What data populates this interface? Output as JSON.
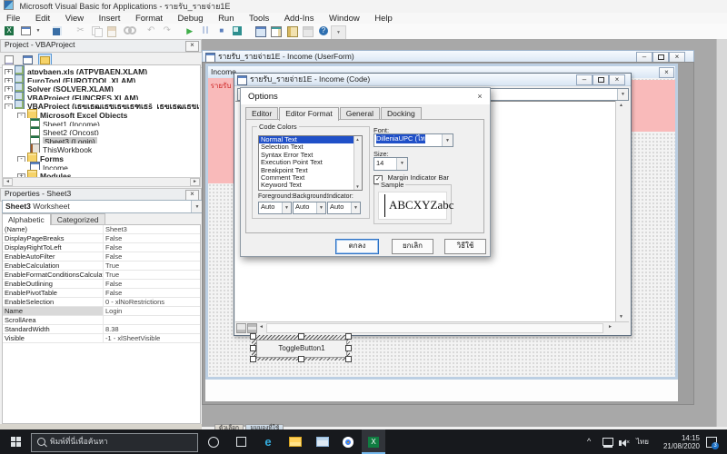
{
  "glyphs": {
    "close": "×",
    "minimize": "–",
    "down": "▼",
    "up": "▲",
    "left": "◄",
    "right": "►",
    "check": "✓",
    "help": "?",
    "scissors": "✂",
    "undo": "↶",
    "redo": "↷",
    "run": "▶",
    "stop": "■",
    "excel_x": "X",
    "edge_e": "e",
    "chevron_up": "^"
  },
  "titlebar": {
    "title": "Microsoft Visual Basic for Applications - รายรับ_รายจ่าย1E"
  },
  "menu": {
    "items": [
      "File",
      "Edit",
      "View",
      "Insert",
      "Format",
      "Debug",
      "Run",
      "Tools",
      "Add-Ins",
      "Window",
      "Help"
    ]
  },
  "project_panel": {
    "title": "Project - VBAProject",
    "tree": [
      {
        "label": "atpvbaen.xls (ATPVBAEN.XLAM)",
        "exp": "+"
      },
      {
        "label": "EuroTool (EUROTOOL.XLAM)",
        "exp": "+"
      },
      {
        "label": "Solver (SOLVER.XLAM)",
        "exp": "+"
      },
      {
        "label": "VBAProject (FUNCRES.XLAM)",
        "exp": "+"
      },
      {
        "label": "VBAProject (เธฃเธฒเธขเธฃเธฑเธš_เธฃเธฒเธขเธˆเนˆเธฒเธข..",
        "exp": "-"
      },
      {
        "label": "Microsoft Excel Objects",
        "exp": "-"
      },
      {
        "label": "Sheet1 (Income)",
        "exp": ""
      },
      {
        "label": "Sheet2 (Oncost)",
        "exp": ""
      },
      {
        "label": "Sheet3 (Login)",
        "exp": "",
        "selected": true
      },
      {
        "label": "ThisWorkbook",
        "exp": ""
      },
      {
        "label": "Forms",
        "exp": "-"
      },
      {
        "label": "Income",
        "exp": ""
      },
      {
        "label": "Modules",
        "exp": "+"
      }
    ]
  },
  "properties_panel": {
    "title": "Properties - Sheet3",
    "object_name": "Sheet3",
    "object_type": "Worksheet",
    "tabs": [
      "Alphabetic",
      "Categorized"
    ],
    "rows": [
      {
        "name": "(Name)",
        "value": "Sheet3"
      },
      {
        "name": "DisplayPageBreaks",
        "value": "False"
      },
      {
        "name": "DisplayRightToLeft",
        "value": "False"
      },
      {
        "name": "EnableAutoFilter",
        "value": "False"
      },
      {
        "name": "EnableCalculation",
        "value": "True"
      },
      {
        "name": "EnableFormatConditionsCalculation",
        "value": "True"
      },
      {
        "name": "EnableOutlining",
        "value": "False"
      },
      {
        "name": "EnablePivotTable",
        "value": "False"
      },
      {
        "name": "EnableSelection",
        "value": "0 - xlNoRestrictions"
      },
      {
        "name": "Name",
        "value": "Login",
        "selected": true
      },
      {
        "name": "ScrollArea",
        "value": ""
      },
      {
        "name": "StandardWidth",
        "value": "8.38"
      },
      {
        "name": "Visible",
        "value": "-1 - xlSheetVisible"
      }
    ]
  },
  "userform_window": {
    "title": "รายรับ_รายจ่าย1E - Income (UserForm)"
  },
  "form": {
    "caption": "Income",
    "header_label": "รายรับ",
    "control_label": "ToggleButton1"
  },
  "code_window": {
    "title": "รายรับ_รายจ่าย1E - Income (Code)",
    "object_combo": "T",
    "procedure_combo": ""
  },
  "options_dialog": {
    "title": "Options",
    "tabs": [
      "Editor",
      "Editor Format",
      "General",
      "Docking"
    ],
    "code_colors": {
      "group_label": "Code Colors",
      "items": [
        "Normal Text",
        "Selection Text",
        "Syntax Error Text",
        "Execution Point Text",
        "Breakpoint Text",
        "Comment Text",
        "Keyword Text"
      ],
      "foreground_label": "Foreground:",
      "background_label": "Background:",
      "indicator_label": "Indicator:",
      "foreground_value": "Auto",
      "background_value": "Auto",
      "indicator_value": "Auto"
    },
    "font_label": "Font:",
    "font_value": "DilleniaUPC (ไท",
    "size_label": "Size:",
    "size_value": "14",
    "margin_indicator_label": "Margin Indicator Bar",
    "margin_indicator_checked": true,
    "sample_group_label": "Sample",
    "sample_text": "ABCXYZabc",
    "buttons": {
      "ok": "ตกลง",
      "cancel": "ยกเลิก",
      "help": "วิธีใช้"
    }
  },
  "excel_fragment": {
    "tabs": [
      "ตัวเลือก",
      "มุมมองที่ใช้"
    ]
  },
  "taskbar": {
    "search_placeholder": "พิมพ์ที่นี่เพื่อค้นหา",
    "tray": {
      "language": "ไทย",
      "time": "14:15",
      "date": "21/08/2020",
      "badge": "3"
    }
  }
}
